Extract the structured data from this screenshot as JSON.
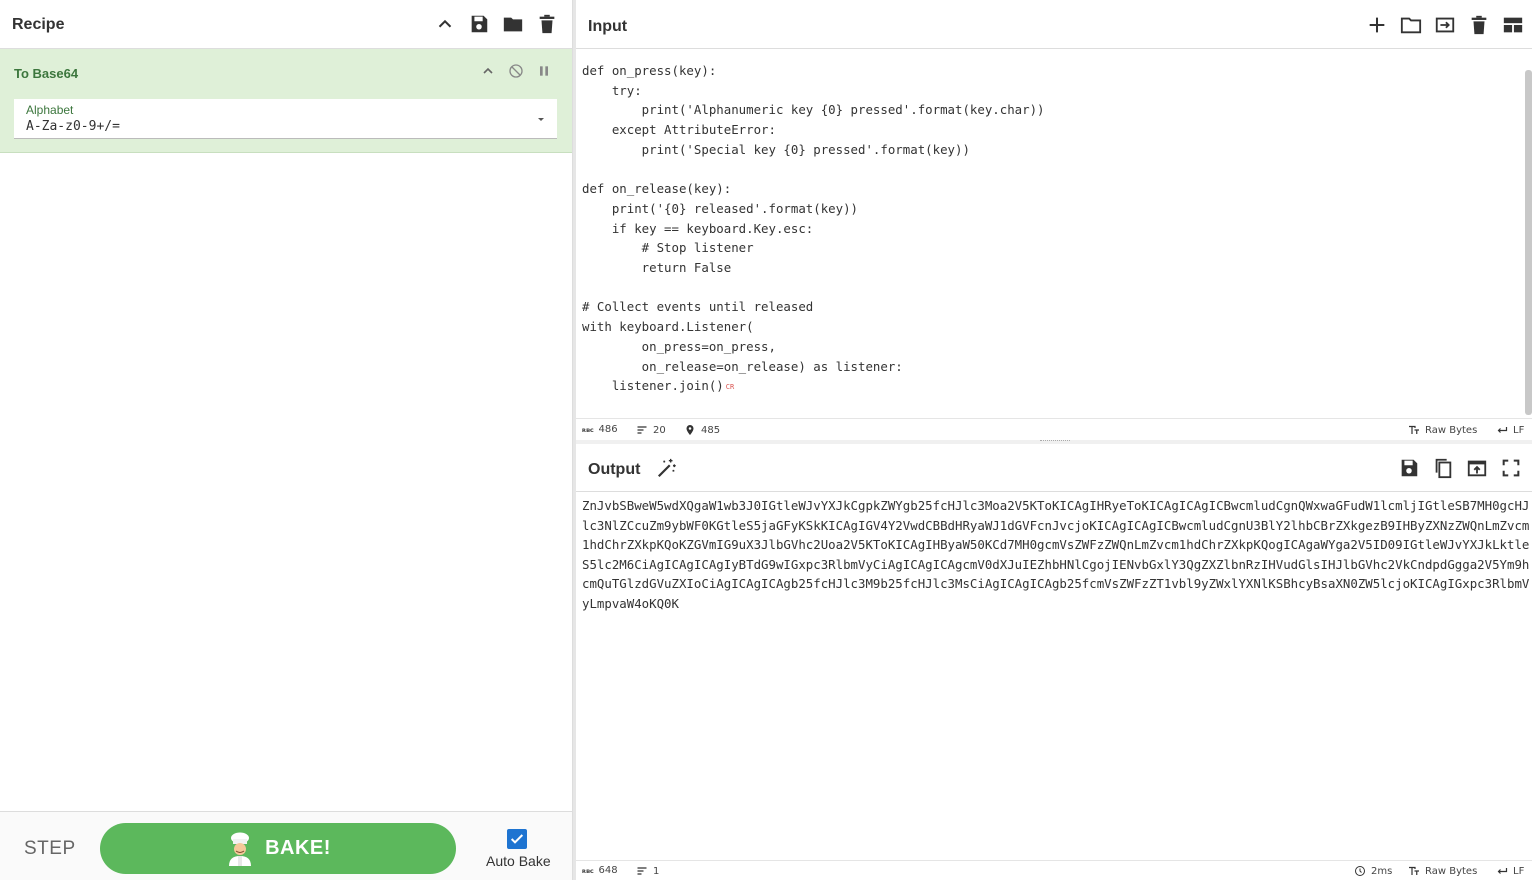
{
  "recipe": {
    "title": "Recipe",
    "operation": {
      "name": "To Base64",
      "alphabet_label": "Alphabet",
      "alphabet_value": "A-Za-z0-9+/="
    },
    "footer": {
      "step_label": "STEP",
      "bake_label": "BAKE!",
      "autobake_label": "Auto Bake",
      "autobake_checked": true
    }
  },
  "input": {
    "title": "Input",
    "code": "def on_press(key):\n    try:\n        print('Alphanumeric key {0} pressed'.format(key.char))\n    except AttributeError:\n        print('Special key {0} pressed'.format(key))\n\ndef on_release(key):\n    print('{0} released'.format(key))\n    if key == keyboard.Key.esc:\n        # Stop listener\n        return False\n\n# Collect events until released\nwith keyboard.Listener(\n        on_press=on_press,\n        on_release=on_release) as listener:\n    listener.join()",
    "eol_marker": "CR",
    "status": {
      "length": "486",
      "lines": "20",
      "position": "485",
      "encoding": "Raw Bytes",
      "eol": "LF"
    }
  },
  "output": {
    "title": "Output",
    "text": "ZnJvbSBweW5wdXQgaW1wb3J0IGtleWJvYXJkCgpkZWYgb25fcHJlc3Moa2V5KToKICAgIHRyeToKICAgICAgICBwcmludCgnQWxwaGFudW1lcmljIGtleSB7MH0gcHJlc3NlZCcuZm9ybWF0KGtleS5jaGFyKSkKICAgIGV4Y2VwdCBBdHRyaWJ1dGVFcnJvcjoKICAgICAgICBwcmludCgnU3BlY2lhbCBrZXkgezB9IHByZXNzZWQnLmZvcm1hdChrZXkpKQoKZGVmIG9uX3JlbGVhc2Uoa2V5KToKICAgIHByaW50KCd7MH0gcmVsZWFzZWQnLmZvcm1hdChrZXkpKQogICAgaWYga2V5ID09IGtleWJvYXJkLktleS5lc2M6CiAgICAgICAgIyBTdG9wIGxpc3RlbmVyCiAgICAgICAgcmV0dXJuIEZhbHNlCgojIENvbGxlY3QgZXZlbnRzIHVudGlsIHJlbGVhc2VkCndpdGgga2V5Ym9hcmQuTGlzdGVuZXIoCiAgICAgICAgb25fcHJlc3M9b25fcHJlc3MsCiAgICAgICAgb25fcmVsZWFzZT1vbl9yZWxlYXNlKSBhcyBsaXN0ZW5lcjoKICAgIGxpc3RlbmVyLmpvaW4oKQ0K",
    "status": {
      "length": "648",
      "lines": "1",
      "time": "2ms",
      "encoding": "Raw Bytes",
      "eol": "LF"
    }
  },
  "icons": {
    "recipe_header": [
      "chevron-up-icon",
      "save-icon",
      "folder-icon",
      "trash-icon"
    ],
    "operation": [
      "chevron-up-icon",
      "disable-icon",
      "pause-icon"
    ],
    "input_header": [
      "plus-icon",
      "folder-icon",
      "sign-in-icon",
      "trash-icon",
      "layout-icon"
    ],
    "output_header": [
      "magic-wand-icon",
      "save-icon",
      "copy-icon",
      "replace-input-icon",
      "fullscreen-icon"
    ]
  },
  "colors": {
    "accent_green": "#5cb85c",
    "operation_bg": "#dff0d8",
    "operation_text": "#3c763d",
    "checkbox_blue": "#1e74d1"
  }
}
